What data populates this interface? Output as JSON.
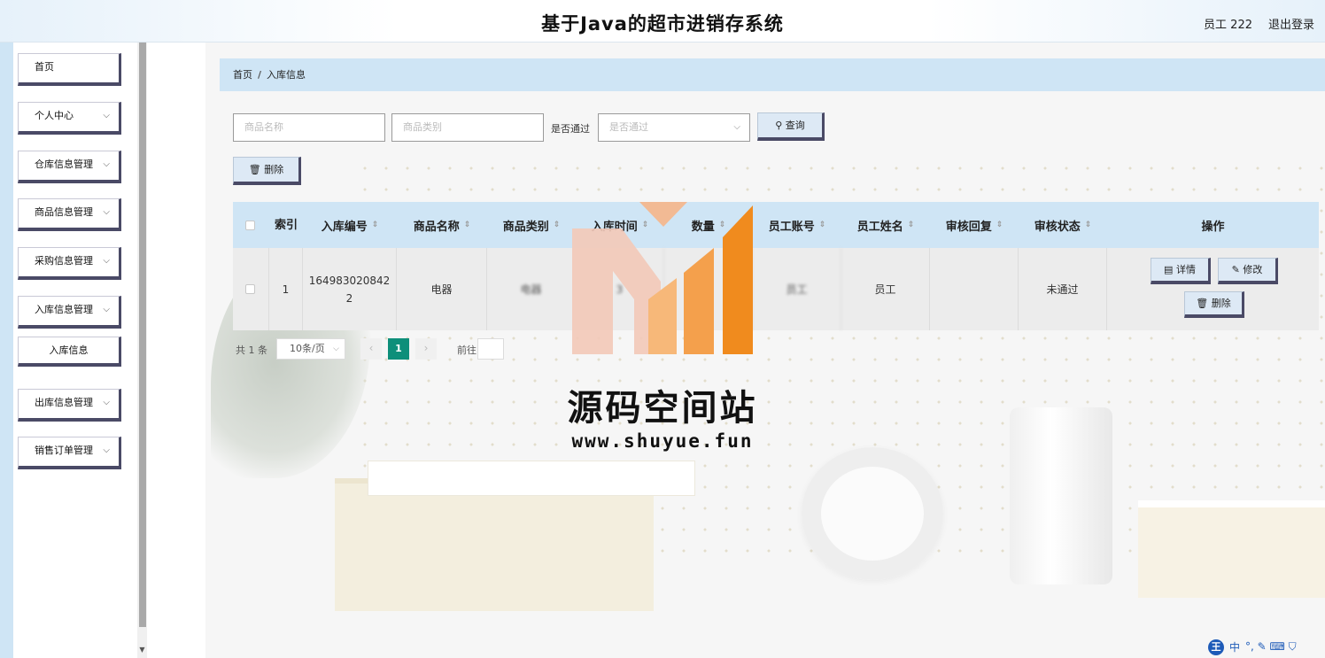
{
  "header": {
    "title": "基于Java的超市进销存系统",
    "user": "员工 222",
    "logout": "退出登录"
  },
  "sidebar": {
    "items": [
      {
        "label": "首页",
        "chevron": ""
      },
      {
        "label": "个人中心",
        "chevron": "⌵"
      },
      {
        "label": "仓库信息管理",
        "chevron": "⌵"
      },
      {
        "label": "商品信息管理",
        "chevron": "⌵"
      },
      {
        "label": "采购信息管理",
        "chevron": "⌵"
      },
      {
        "label": "入库信息管理",
        "chevron": "⌵"
      },
      {
        "label": "入库信息",
        "chevron": ""
      },
      {
        "label": "出库信息管理",
        "chevron": "⌵"
      },
      {
        "label": "销售订单管理",
        "chevron": "⌵"
      }
    ]
  },
  "breadcrumb": {
    "home": "首页",
    "separator": "/",
    "current": "入库信息"
  },
  "search": {
    "product_name_placeholder": "商品名称",
    "product_category_placeholder": "商品类别",
    "approved_label": "是否通过",
    "approved_placeholder": "是否通过",
    "query_label": "查询",
    "delete_label": "删除"
  },
  "table": {
    "columns": {
      "index": "索引",
      "inbound_no": "入库编号",
      "product_name": "商品名称",
      "product_category": "商品类别",
      "inbound_time": "入库时间",
      "quantity": "数量",
      "staff_account": "员工账号",
      "staff_name": "员工姓名",
      "review_reply": "审核回复",
      "review_status": "审核状态",
      "actions": "操作"
    },
    "rows": [
      {
        "index": "1",
        "inbound_no": "1649830208422",
        "product_name": "电器",
        "product_category": "电器",
        "inbound_time": "3",
        "quantity": "1",
        "staff_account": "员工",
        "staff_name": "员工",
        "review_reply": "",
        "review_status": "未通过",
        "detail_label": "详情",
        "edit_label": "修改",
        "delete_label": "删除"
      }
    ]
  },
  "pagination": {
    "total": "共 1 条",
    "page_size": "10条/页",
    "current_page": "1",
    "goto_label": "前往",
    "prev": "‹",
    "next": "›"
  },
  "watermark": {
    "title": "源码空间站",
    "url": "www.shuyue.fun"
  },
  "tray": {
    "badge": "王",
    "lang": "中",
    "icons": "°, ✎ ⌨ ⛉"
  },
  "colors": {
    "accent_light_blue": "#cfe5f5",
    "button_border": "#4a4a66",
    "page_active": "#0e8f7a"
  }
}
